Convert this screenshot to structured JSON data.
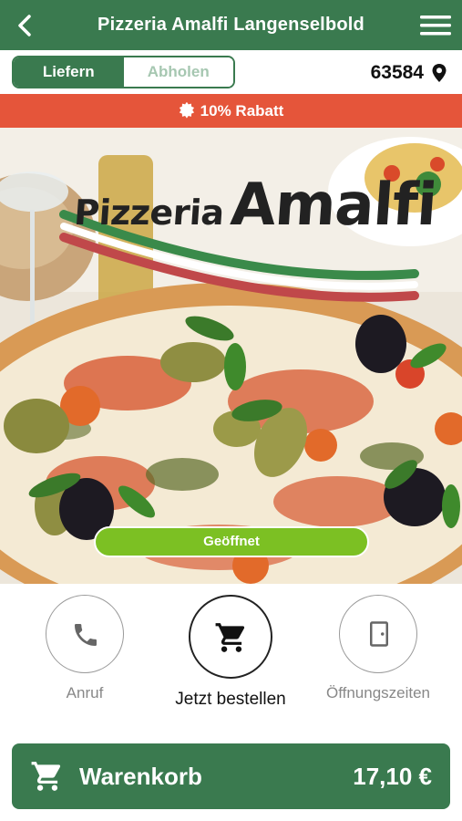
{
  "header": {
    "title": "Pizzeria Amalfi Langenselbold",
    "back_icon": "chevron-left-icon",
    "menu_icon": "hamburger-menu-icon"
  },
  "mode_switch": {
    "options": [
      {
        "label": "Liefern",
        "active": true
      },
      {
        "label": "Abholen",
        "active": false
      }
    ]
  },
  "location": {
    "postal_code": "63584",
    "icon": "map-pin-icon"
  },
  "promo_banner": {
    "text": "10% Rabatt",
    "icon": "badge-icon",
    "color": "#e5553a"
  },
  "hero": {
    "logo_text_1": "Pizzeria",
    "logo_text_2": "Amalfi",
    "status_button": "Geöffnet",
    "status_color": "#7cc023"
  },
  "actions": [
    {
      "label": "Anruf",
      "icon": "phone-icon"
    },
    {
      "label": "Jetzt bestellen",
      "icon": "shopping-cart-icon"
    },
    {
      "label": "Öffnungszeiten",
      "icon": "door-icon"
    }
  ],
  "cart": {
    "label": "Warenkorb",
    "total": "17,10 €",
    "icon": "shopping-cart-icon"
  },
  "colors": {
    "brand_green": "#3a7a4f",
    "accent_red": "#e5553a",
    "open_green": "#7cc023"
  }
}
